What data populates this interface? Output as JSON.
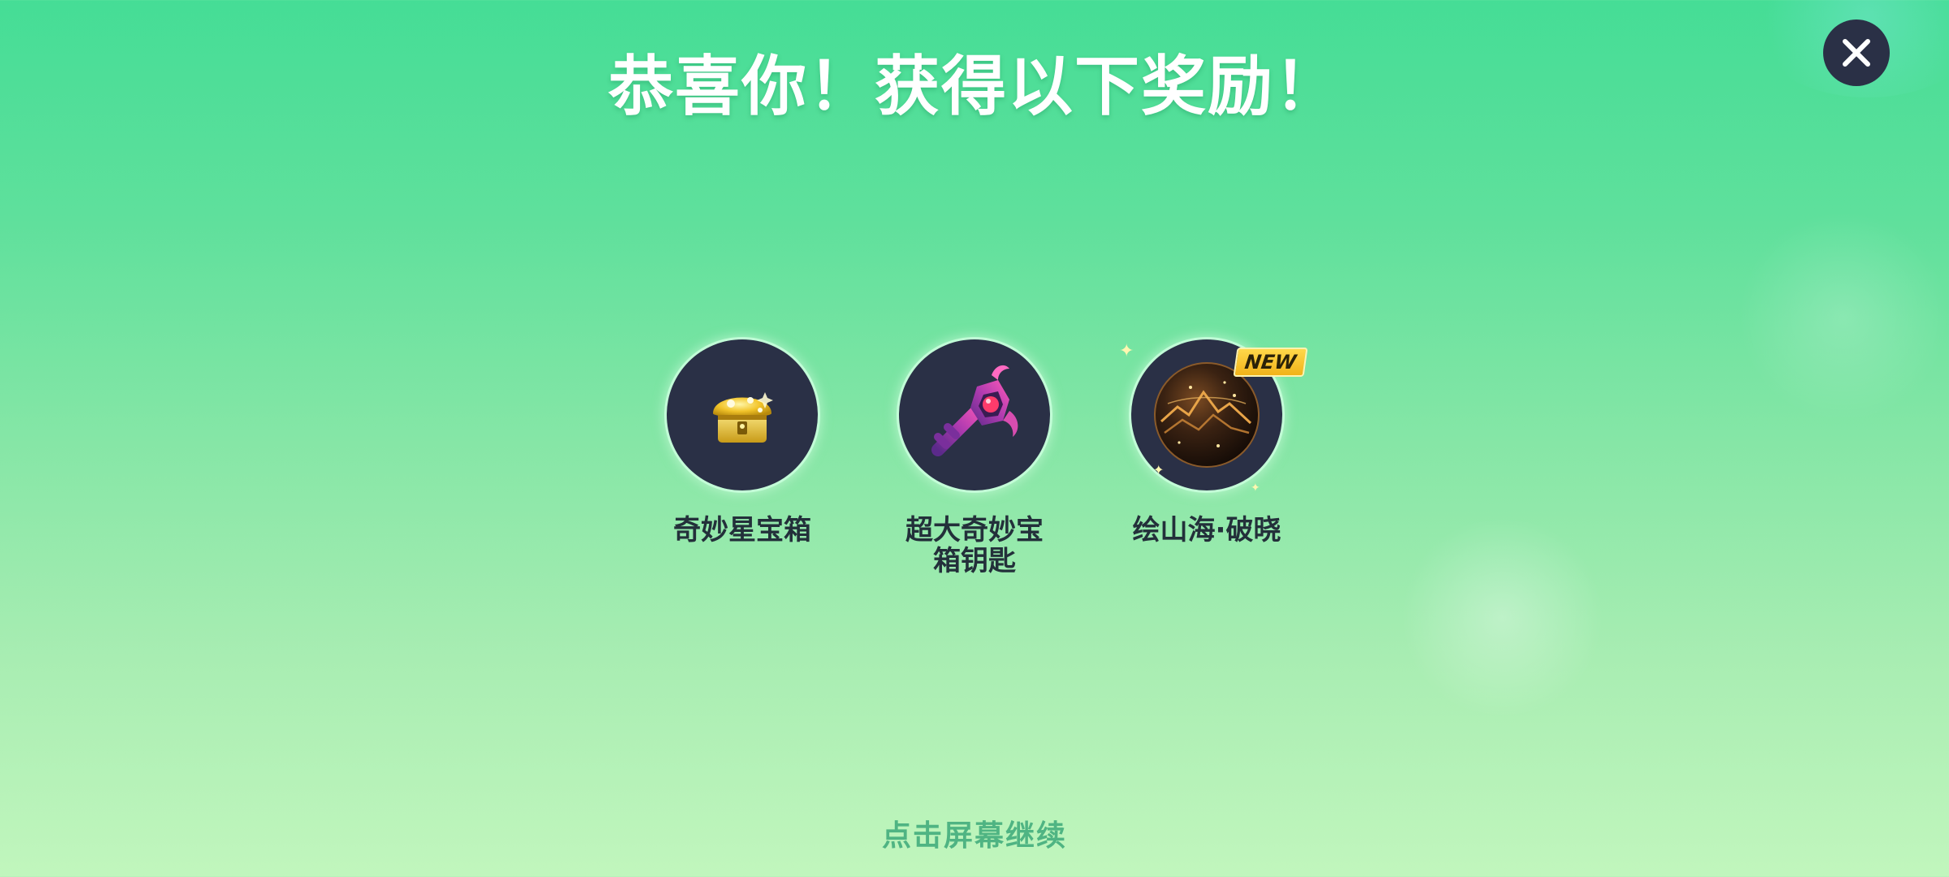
{
  "header": {
    "title": "恭喜你！获得以下奖励！"
  },
  "close_button": {
    "icon": "close-icon"
  },
  "rewards": [
    {
      "name": "奇妙星宝箱",
      "icon": "treasure-chest-icon",
      "is_new": false
    },
    {
      "name": "超大奇妙宝箱钥匙",
      "icon": "key-icon",
      "is_new": false
    },
    {
      "name": "绘山海·破晓",
      "icon": "orb-icon",
      "is_new": true,
      "badge": "NEW"
    }
  ],
  "footer": {
    "hint": "点击屏幕继续"
  },
  "colors": {
    "background_top": "#45dd96",
    "background_bottom": "#c1f6bd",
    "circle": "#2a3046",
    "badge": "#f1b21a",
    "hint": "#4fb483"
  }
}
